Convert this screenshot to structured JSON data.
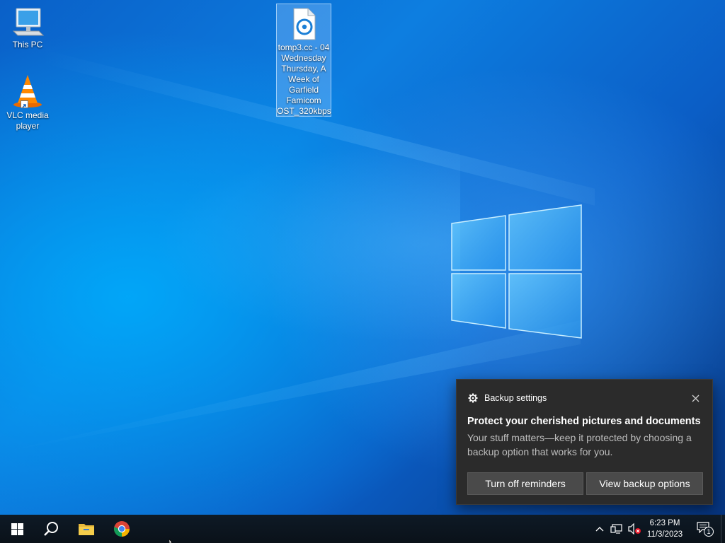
{
  "desktop": {
    "icons": [
      {
        "label": "This PC",
        "icon": "this-pc-icon"
      },
      {
        "label": "VLC media player",
        "icon": "vlc-cone-icon"
      },
      {
        "label": "tomp3.cc - 04 Wednesday Thursday, A Week of Garfield Famicom OST_320kbps",
        "icon": "audio-file-icon",
        "selected": true
      }
    ]
  },
  "notification": {
    "app": "Backup settings",
    "app_icon": "gear-icon",
    "title": "Protect your cherished pictures and documents",
    "body": "Your stuff matters—keep it protected by choosing a backup option that works for you.",
    "buttons": {
      "primary": "Turn off reminders",
      "secondary": "View backup options"
    }
  },
  "taskbar": {
    "pinned": [
      "windows-start-icon",
      "search-icon",
      "file-explorer-icon",
      "chrome-icon"
    ],
    "tray": {
      "icons": [
        "chevron-up-icon",
        "network-icon",
        "volume-muted-icon"
      ],
      "time": "6:23 PM",
      "date": "11/3/2023",
      "notification_count": "1"
    }
  },
  "colors": {
    "toast_bg": "#2b2b2b",
    "button_bg": "#4a4a4a",
    "taskbar_bg": "#0e1a26",
    "selection": "#7fb6ff"
  }
}
